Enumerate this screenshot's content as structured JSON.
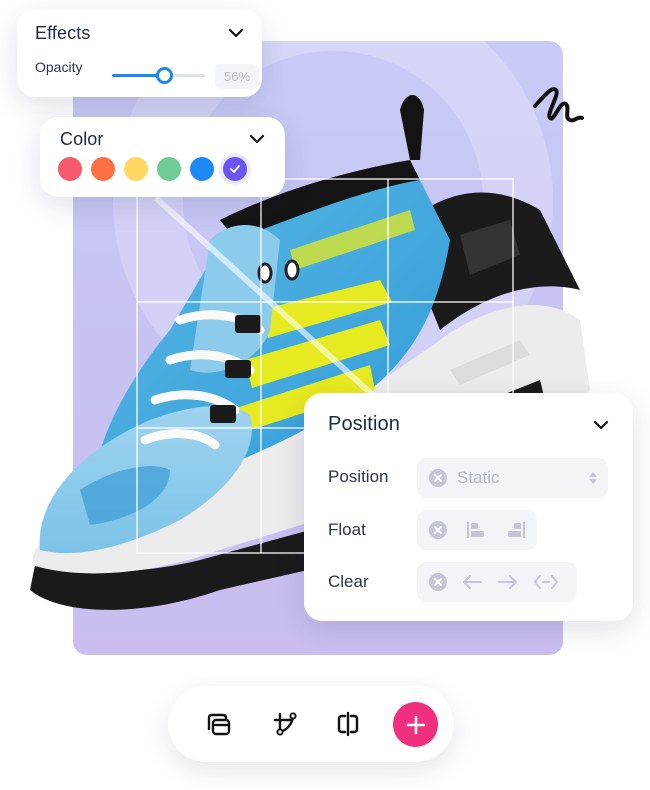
{
  "effects": {
    "title": "Effects",
    "opacity_label": "Opacity",
    "opacity_percent": 56,
    "opacity_display": "56%"
  },
  "color": {
    "title": "Color",
    "swatches": [
      {
        "name": "red",
        "hex": "#f65a6c"
      },
      {
        "name": "orange",
        "hex": "#fd7046"
      },
      {
        "name": "yellow",
        "hex": "#fed863"
      },
      {
        "name": "green",
        "hex": "#6fcc93"
      },
      {
        "name": "blue",
        "hex": "#1e88f5"
      },
      {
        "name": "purple",
        "hex": "#6a55f5",
        "selected": true
      }
    ]
  },
  "position_panel": {
    "title": "Position",
    "rows": [
      {
        "label": "Position",
        "value": "Static",
        "icons": [
          "clear-icon",
          "up-down-icon"
        ]
      },
      {
        "label": "Float",
        "icons": [
          "clear-icon",
          "float-left-icon",
          "float-right-icon"
        ]
      },
      {
        "label": "Clear",
        "icons": [
          "clear-icon",
          "arrow-left-icon",
          "arrow-right-icon",
          "arrow-both-icon"
        ]
      }
    ]
  },
  "toolbar": {
    "tools": [
      "layers-icon",
      "pen-tool-icon",
      "flip-icon"
    ],
    "add_button": "add-icon",
    "accent": "#f0307e"
  },
  "colors": {
    "accent_blue": "#1e86f0",
    "canvas_bg": "#c8c6f4",
    "text_dark": "#1c2747",
    "muted": "#b3b6c8"
  }
}
